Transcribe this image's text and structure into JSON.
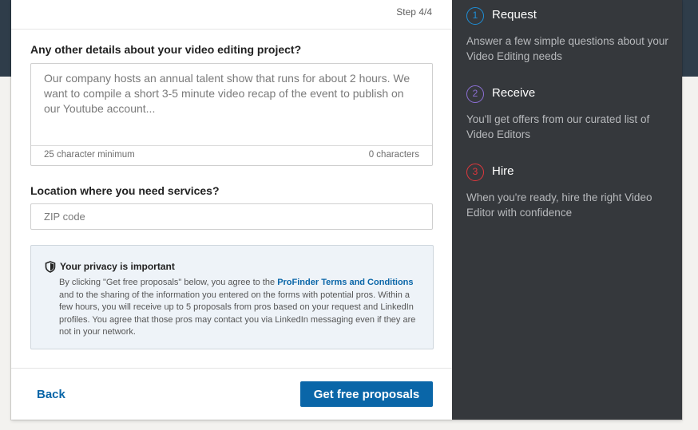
{
  "form": {
    "step_label": "Step 4/4",
    "question_details": "Any other details about your video editing project?",
    "details_placeholder": "Our company hosts an annual talent show that runs for about 2 hours. We want to compile a short 3-5 minute video recap of the event to publish on our Youtube account...",
    "details_min_hint": "25 character minimum",
    "details_char_count": "0 characters",
    "question_location": "Location where you need services?",
    "zip_placeholder": "ZIP code",
    "privacy": {
      "icon": "shield-icon",
      "title": "Your privacy is important",
      "text_before": "By clicking \"Get free proposals\" below, you agree to the ",
      "link": "ProFinder Terms and Conditions",
      "text_after": " and to the sharing of the information you entered on the forms with potential pros. Within a few hours, you will receive up to 5 proposals from pros based on your request and LinkedIn profiles. You agree that those pros may contact you via LinkedIn messaging even if they are not in your network."
    },
    "back_label": "Back",
    "submit_label": "Get free proposals"
  },
  "steps": [
    {
      "number": "1",
      "title": "Request",
      "description": "Answer a few simple questions about your Video Editing needs",
      "color": "#1e8fd8"
    },
    {
      "number": "2",
      "title": "Receive",
      "description": "You'll get offers from our curated list of Video Editors",
      "color": "#8c6fd4"
    },
    {
      "number": "3",
      "title": "Hire",
      "description": "When you're ready, hire the right Video Editor with confidence",
      "color": "#e0373c"
    }
  ],
  "colors": {
    "accent": "#0a66a8",
    "side_panel": "#35383c",
    "header_band": "#2f3d4a"
  }
}
